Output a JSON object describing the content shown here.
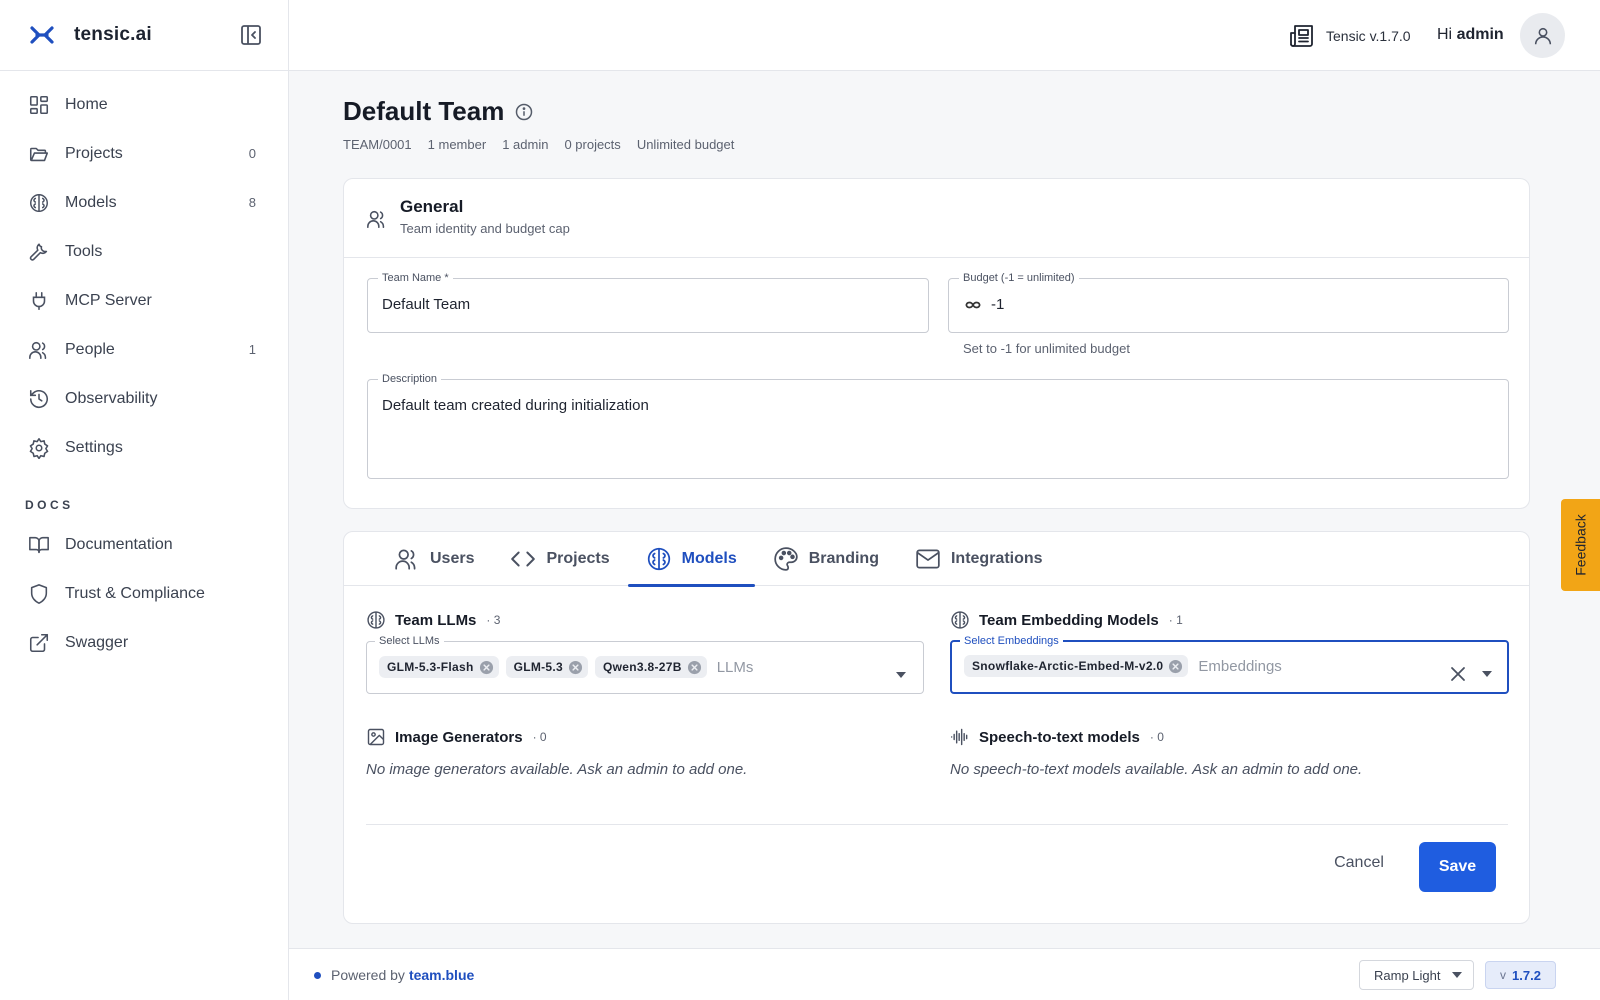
{
  "brand": {
    "name": "tensic.ai",
    "accent": "#1f4fbf"
  },
  "nav": {
    "items": [
      {
        "label": "Home",
        "count": "",
        "icon": "dashboard-icon"
      },
      {
        "label": "Projects",
        "count": "0",
        "icon": "folder-icon"
      },
      {
        "label": "Models",
        "count": "8",
        "icon": "brain-icon"
      },
      {
        "label": "Tools",
        "count": "",
        "icon": "wrench-icon"
      },
      {
        "label": "MCP Server",
        "count": "",
        "icon": "plug-icon"
      },
      {
        "label": "People",
        "count": "1",
        "icon": "users-icon"
      },
      {
        "label": "Observability",
        "count": "",
        "icon": "history-icon"
      },
      {
        "label": "Settings",
        "count": "",
        "icon": "gear-icon"
      }
    ],
    "docs_heading": "DOCS",
    "docs": [
      {
        "label": "Documentation",
        "icon": "book-icon"
      },
      {
        "label": "Trust & Compliance",
        "icon": "shield-icon"
      },
      {
        "label": "Swagger",
        "icon": "external-link-icon"
      }
    ]
  },
  "header": {
    "version": "Tensic v.1.7.0",
    "greeting": "Hi",
    "user": "admin"
  },
  "page": {
    "title": "Default Team",
    "meta": [
      "TEAM/0001",
      "1 member",
      "1 admin",
      "0 projects",
      "Unlimited budget"
    ]
  },
  "general": {
    "title": "General",
    "subtitle": "Team identity and budget cap",
    "team_name_label": "Team Name *",
    "team_name_value": "Default Team",
    "budget_label": "Budget (-1 = unlimited)",
    "budget_value": "-1",
    "budget_help": "Set to -1 for unlimited budget",
    "description_label": "Description",
    "description_value": "Default team created during initialization"
  },
  "tabs": [
    {
      "label": "Users",
      "icon": "users-icon",
      "active": false
    },
    {
      "label": "Projects",
      "icon": "code-icon",
      "active": false
    },
    {
      "label": "Models",
      "icon": "brain-icon",
      "active": true
    },
    {
      "label": "Branding",
      "icon": "palette-icon",
      "active": false
    },
    {
      "label": "Integrations",
      "icon": "mail-icon",
      "active": false
    }
  ],
  "models": {
    "llms": {
      "title": "Team LLMs",
      "count": "· 3",
      "label": "Select LLMs",
      "chips": [
        "GLM-5.3-Flash",
        "GLM-5.3",
        "Qwen3.8-27B"
      ],
      "placeholder": "LLMs"
    },
    "embeddings": {
      "title": "Team Embedding Models",
      "count": "· 1",
      "label": "Select Embeddings",
      "chips": [
        "Snowflake-Arctic-Embed-M-v2.0"
      ],
      "placeholder": "Embeddings"
    },
    "image": {
      "title": "Image Generators",
      "count": "· 0",
      "empty": "No image generators available. Ask an admin to add one."
    },
    "stt": {
      "title": "Speech-to-text models",
      "count": "· 0",
      "empty": "No speech-to-text models available. Ask an admin to add one."
    }
  },
  "actions": {
    "cancel": "Cancel",
    "save": "Save"
  },
  "footer": {
    "powered_prefix": "Powered by",
    "powered_link": "team.blue",
    "theme": "Ramp Light",
    "version_prefix": "v",
    "version": "1.7.2"
  },
  "feedback": "Feedback"
}
